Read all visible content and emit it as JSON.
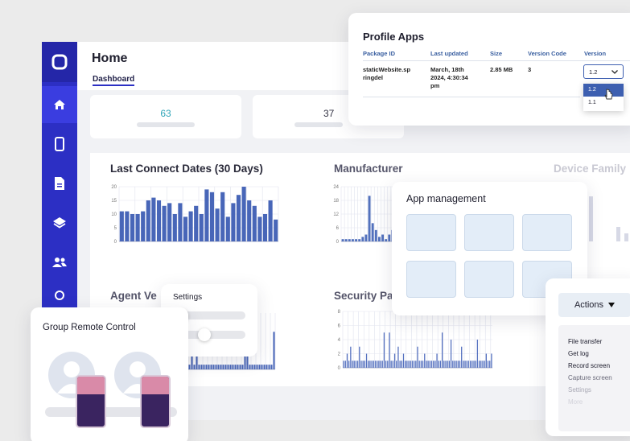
{
  "sidebar": {
    "items": [
      {
        "icon": "home-icon",
        "active": true
      },
      {
        "icon": "phone-icon"
      },
      {
        "icon": "document-icon"
      },
      {
        "icon": "layers-icon"
      },
      {
        "icon": "users-icon"
      },
      {
        "icon": "settings-icon"
      }
    ],
    "accent": "#2c2fc4"
  },
  "header": {
    "title": "Home",
    "tab": "Dashboard"
  },
  "stats": [
    {
      "value": "63",
      "color": "#2fa5b8"
    },
    {
      "value": "37",
      "color": "#333344"
    }
  ],
  "charts": {
    "last_connect": {
      "title": "Last Connect Dates (30 Days)"
    },
    "manufacturer": {
      "title": "Manufacturer"
    },
    "device_family": {
      "title": "Device Family"
    },
    "agent_version": {
      "title": "Agent Ve"
    },
    "security": {
      "title": "Security Pa"
    }
  },
  "chart_data": [
    {
      "type": "bar",
      "title": "Last Connect Dates (30 Days)",
      "ylim": [
        0,
        20
      ],
      "yticks": [
        "0",
        "5",
        "10",
        "15",
        "20"
      ],
      "values": [
        11,
        11,
        10,
        10,
        11,
        15,
        16,
        15,
        13,
        14,
        10,
        14,
        9,
        11,
        13,
        10,
        19,
        18,
        12,
        18,
        9,
        14,
        17,
        20,
        15,
        13,
        9,
        10,
        15,
        8
      ]
    },
    {
      "type": "bar",
      "title": "Manufacturer",
      "ylim": [
        0,
        24
      ],
      "yticks": [
        "0",
        "6",
        "12",
        "18",
        "24"
      ],
      "values": [
        1,
        1,
        1,
        1,
        1,
        1,
        2,
        3,
        20,
        8,
        5,
        2,
        3,
        1,
        3,
        5
      ]
    },
    {
      "type": "bar",
      "title": "Security Pa",
      "ylim": [
        0,
        8
      ],
      "yticks": [
        "0",
        "2",
        "4",
        "6",
        "8"
      ],
      "values": [
        1,
        1,
        2,
        1,
        3,
        1,
        1,
        1,
        1,
        3,
        1,
        1,
        1,
        2,
        1,
        1,
        1,
        1,
        1,
        1,
        1,
        1,
        1,
        5,
        1,
        1,
        5,
        1,
        1,
        2,
        1,
        3,
        1,
        1,
        2,
        1,
        1,
        1,
        1,
        1,
        1,
        1,
        3,
        1,
        1,
        1,
        2,
        1,
        1,
        1,
        1,
        1,
        1,
        2,
        1,
        1,
        5,
        1,
        1,
        1,
        1,
        4,
        1,
        1,
        1,
        1,
        1,
        3,
        1,
        1,
        1,
        1,
        1,
        1,
        1,
        1,
        4,
        1,
        1,
        1,
        1,
        2,
        1,
        1,
        2
      ]
    },
    {
      "type": "bar",
      "title": "Agent Ve",
      "values": [
        1,
        3,
        1,
        7,
        1,
        1,
        1,
        1,
        1,
        1,
        1,
        1,
        1,
        1,
        1,
        1,
        1,
        1,
        1,
        1,
        1,
        1,
        1,
        3,
        12,
        1,
        1,
        1,
        1,
        1,
        1,
        1,
        1,
        1,
        1,
        8
      ]
    }
  ],
  "profile_apps": {
    "title": "Profile Apps",
    "columns": [
      "Package ID",
      "Last updated",
      "Size",
      "Version Code",
      "Version"
    ],
    "row": {
      "package": [
        "staticWebsite.sp",
        "ringdel"
      ],
      "updated": [
        "March, 18th",
        "2024, 4:30:34",
        "pm"
      ],
      "size": "2.85 MB",
      "code": "3",
      "version": "1.2"
    },
    "options": [
      "1.2",
      "1.1"
    ]
  },
  "app_management": {
    "title": "App management"
  },
  "actions": {
    "label": "Actions",
    "items": [
      "File transfer",
      "Get log",
      "Record screen",
      "Capture screen",
      "Settings",
      "More"
    ]
  },
  "settings": {
    "title": "Settings"
  },
  "group_remote": {
    "title": "Group Remote Control"
  }
}
